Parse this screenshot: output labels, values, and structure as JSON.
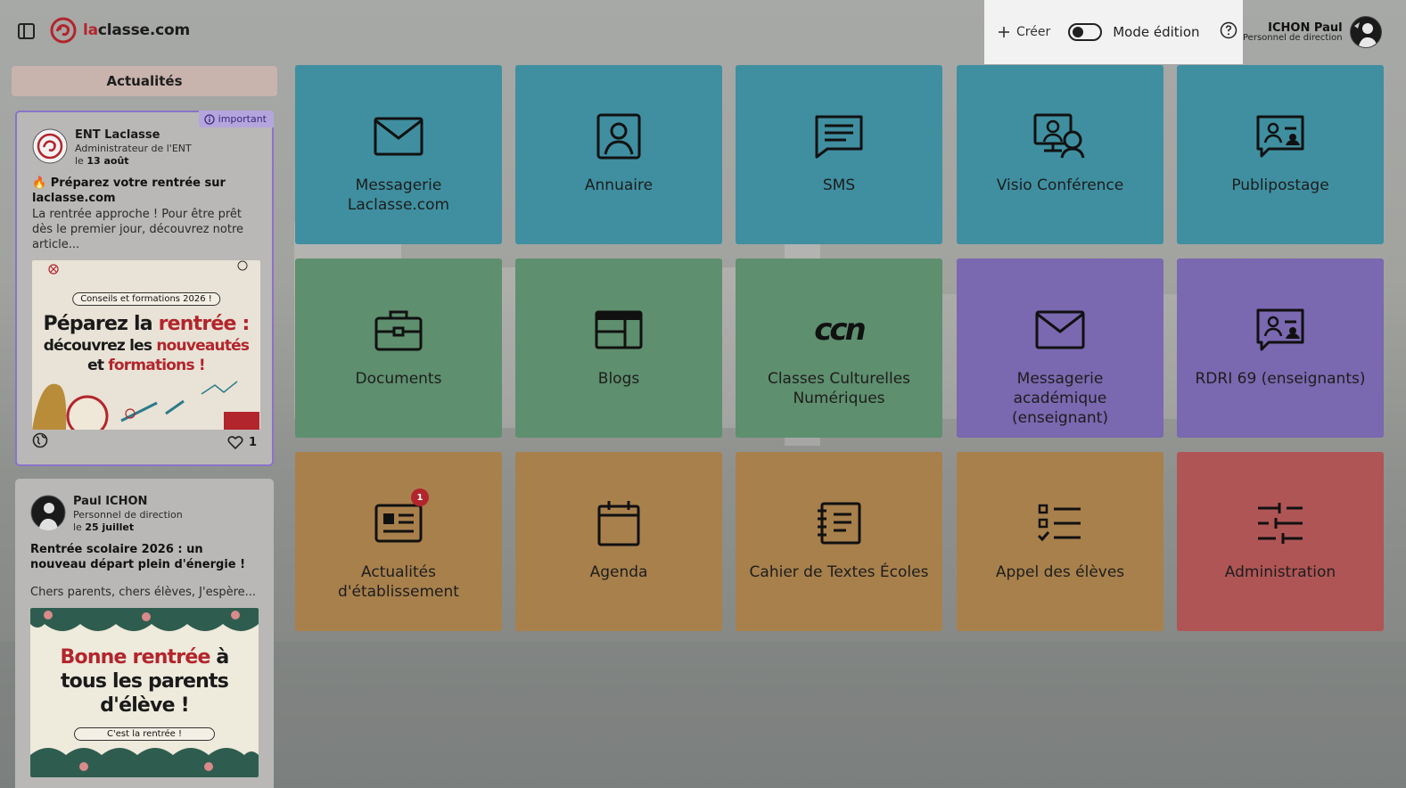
{
  "app": {
    "logo_prefix": "la",
    "logo_suffix": "classe.com"
  },
  "header": {
    "create_label": "Créer",
    "mode_label": "Mode édition",
    "user_name": "ICHON Paul",
    "user_role": "Personnel de direction"
  },
  "news": {
    "title": "Actualités",
    "posts": [
      {
        "badge": "important",
        "author": "ENT Laclasse",
        "role": "Administrateur de l'ENT",
        "date_prefix": "le",
        "date": "13 août",
        "title": "🔥 Préparez votre rentrée sur laclasse.com",
        "excerpt": "La rentrée approche ! Pour être prêt dès le premier jour, découvrez notre article...",
        "image_caption": "Conseils et formations 2026 !",
        "image_line1": "Péparez la",
        "image_line1b": "rentrée :",
        "image_line2": "découvrez les",
        "image_line2b": "nouveautés",
        "image_line3": "et",
        "image_line3b": "formations !",
        "likes": "1"
      },
      {
        "author": "Paul ICHON",
        "role": "Personnel de direction",
        "date_prefix": "le",
        "date": "25 juillet",
        "title": "Rentrée scolaire 2026 : un nouveau départ plein d'énergie !",
        "excerpt": "Chers parents, chers élèves, J'espère...",
        "image_line1": "Bonne rentrée",
        "image_line1b": "à",
        "image_line2": "tous les parents",
        "image_line3": "d'élève !",
        "image_caption": "C'est la rentrée !"
      }
    ]
  },
  "tiles": [
    {
      "label": "Messagerie Laclasse.com",
      "icon": "mail-icon"
    },
    {
      "label": "Annuaire",
      "icon": "contact-icon"
    },
    {
      "label": "SMS",
      "icon": "message-icon"
    },
    {
      "label": "Visio Conférence",
      "icon": "video-call-icon"
    },
    {
      "label": "Publipostage",
      "icon": "mailing-icon"
    },
    {
      "label": "Documents",
      "icon": "briefcase-icon"
    },
    {
      "label": "Blogs",
      "icon": "browser-icon"
    },
    {
      "label": "Classes Culturelles Numériques",
      "icon": "ccn-logo-icon",
      "logo_text": "ccn"
    },
    {
      "label": "Messagerie académique (enseignant)",
      "icon": "mail-icon"
    },
    {
      "label": "RDRI 69 (enseignants)",
      "icon": "mailing-icon"
    },
    {
      "label": "Actualités d'établissement",
      "icon": "news-icon",
      "notification": "1"
    },
    {
      "label": "Agenda",
      "icon": "calendar-icon"
    },
    {
      "label": "Cahier de Textes Écoles",
      "icon": "notebook-icon"
    },
    {
      "label": "Appel des élèves",
      "icon": "checklist-icon"
    },
    {
      "label": "Administration",
      "icon": "sliders-icon"
    }
  ],
  "colors": {
    "blue": "#3f8fa0",
    "green": "#5e8f6e",
    "purple": "#7a68b0",
    "orange": "#a8804c",
    "red": "#b05555",
    "brand": "#b3252c"
  }
}
